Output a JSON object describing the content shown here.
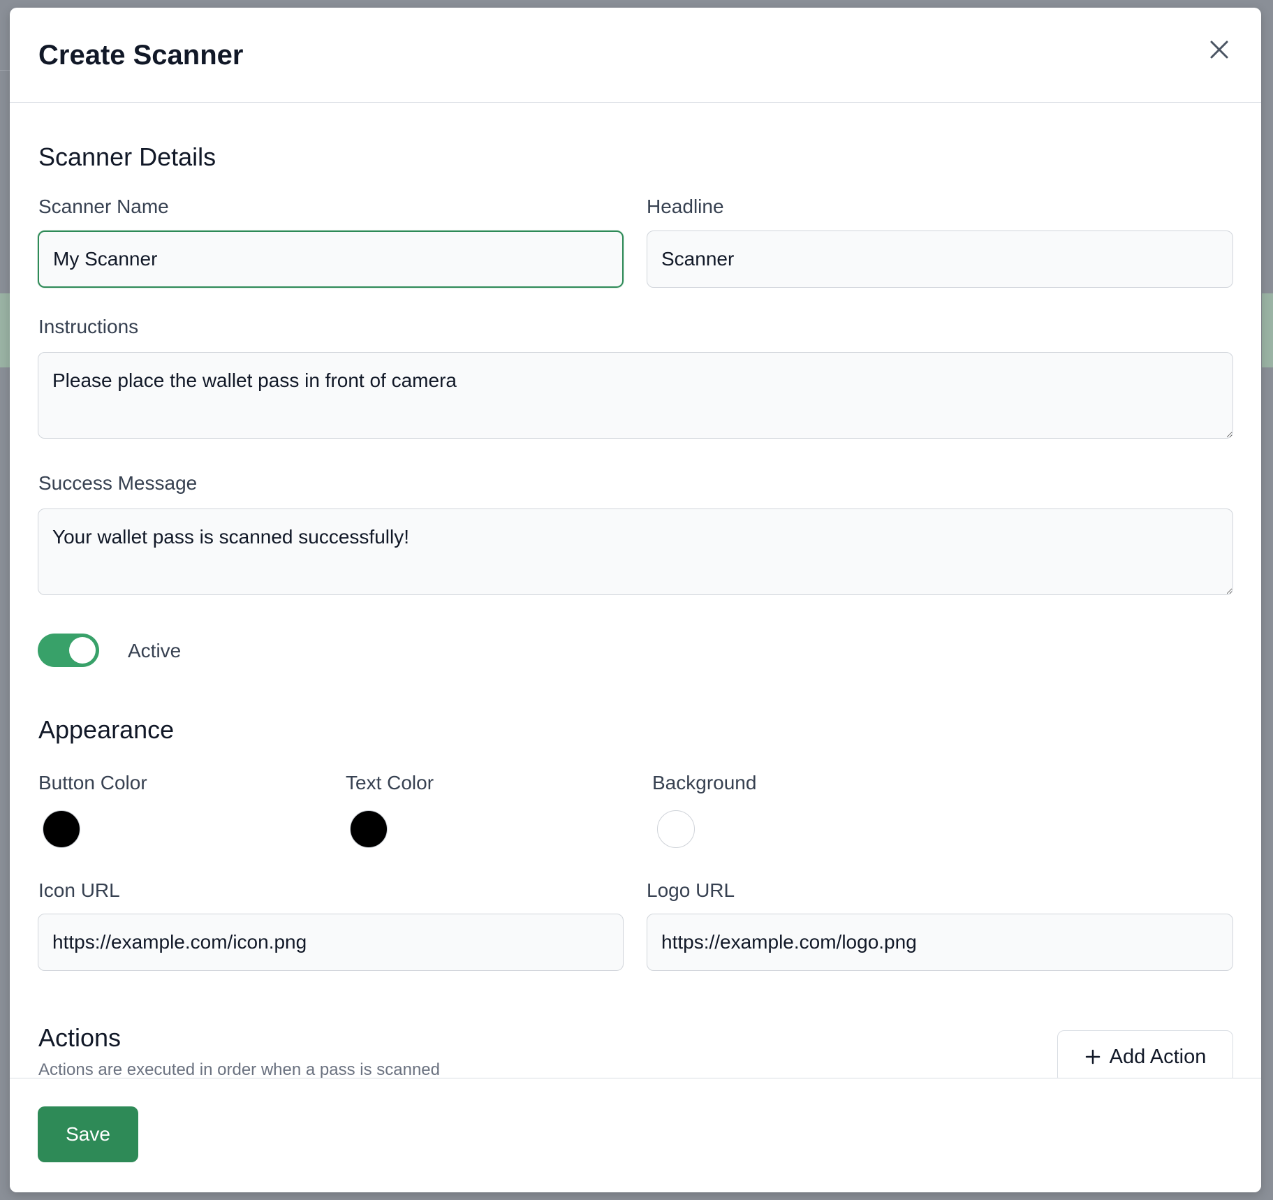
{
  "modal": {
    "title": "Create Scanner",
    "close_icon": "close-icon"
  },
  "details": {
    "section_title": "Scanner Details",
    "scanner_name": {
      "label": "Scanner Name",
      "value": "My Scanner"
    },
    "headline": {
      "label": "Headline",
      "value": "Scanner"
    },
    "instructions": {
      "label": "Instructions",
      "value": "Please place the wallet pass in front of camera"
    },
    "success_message": {
      "label": "Success Message",
      "value": "Your wallet pass is scanned successfully!"
    },
    "active": {
      "label": "Active",
      "on": true
    }
  },
  "appearance": {
    "section_title": "Appearance",
    "button_color": {
      "label": "Button Color",
      "color": "#000000"
    },
    "text_color": {
      "label": "Text Color",
      "color": "#000000"
    },
    "background": {
      "label": "Background",
      "color": "#ffffff"
    },
    "icon_url": {
      "label": "Icon URL",
      "value": "https://example.com/icon.png"
    },
    "logo_url": {
      "label": "Logo URL",
      "value": "https://example.com/logo.png"
    }
  },
  "actions": {
    "section_title": "Actions",
    "subtitle": "Actions are executed in order when a pass is scanned",
    "add_label": "Add Action"
  },
  "footer": {
    "save_label": "Save"
  },
  "colors": {
    "accent": "#2e8a57",
    "toggle_on": "#38a169"
  }
}
